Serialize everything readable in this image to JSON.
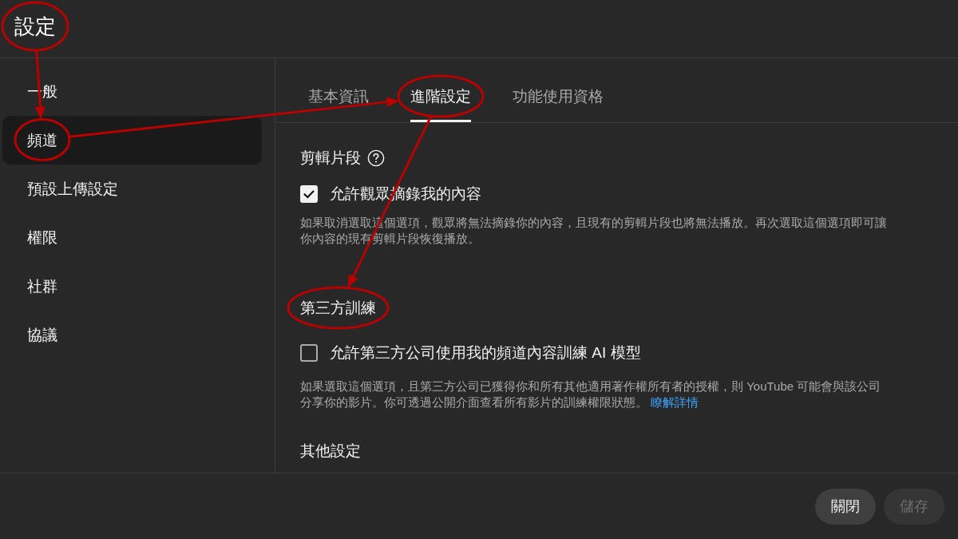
{
  "header": {
    "title": "設定",
    "circled": true
  },
  "sidebar": {
    "items": [
      {
        "label": "一般",
        "selected": false,
        "circled": false
      },
      {
        "label": "頻道",
        "selected": true,
        "circled": true
      },
      {
        "label": "預設上傳設定",
        "selected": false,
        "circled": false
      },
      {
        "label": "權限",
        "selected": false,
        "circled": false
      },
      {
        "label": "社群",
        "selected": false,
        "circled": false
      },
      {
        "label": "協議",
        "selected": false,
        "circled": false
      }
    ]
  },
  "tabs": [
    {
      "label": "基本資訊",
      "selected": false,
      "circled": false
    },
    {
      "label": "進階設定",
      "selected": true,
      "circled": true
    },
    {
      "label": "功能使用資格",
      "selected": false,
      "circled": false
    }
  ],
  "sections": [
    {
      "title": "剪輯片段",
      "help": true,
      "circled": false,
      "option": {
        "label": "允許觀眾摘錄我的內容",
        "checked": true
      },
      "description": "如果取消選取這個選項，觀眾將無法摘錄你的內容，且現有的剪輯片段也將無法播放。再次選取這個選項即可讓你內容的現有剪輯片段恢復播放。"
    },
    {
      "title": "第三方訓練",
      "help": false,
      "circled": true,
      "option": {
        "label": "允許第三方公司使用我的頻道內容訓練 AI 模型",
        "checked": false
      },
      "description": "如果選取這個選項，且第三方公司已獲得你和所有其他適用著作權所有者的授權，則 YouTube 可能會與該公司分享你的影片。你可透過公開介面查看所有影片的訓練權限狀態。",
      "link": "瞭解詳情"
    },
    {
      "title": "其他設定",
      "help": false,
      "circled": false
    }
  ],
  "footer": {
    "buttons": [
      {
        "label": "關閉",
        "disabled": false
      },
      {
        "label": "儲存",
        "disabled": true
      }
    ]
  },
  "annotations": {
    "arrows": true
  }
}
